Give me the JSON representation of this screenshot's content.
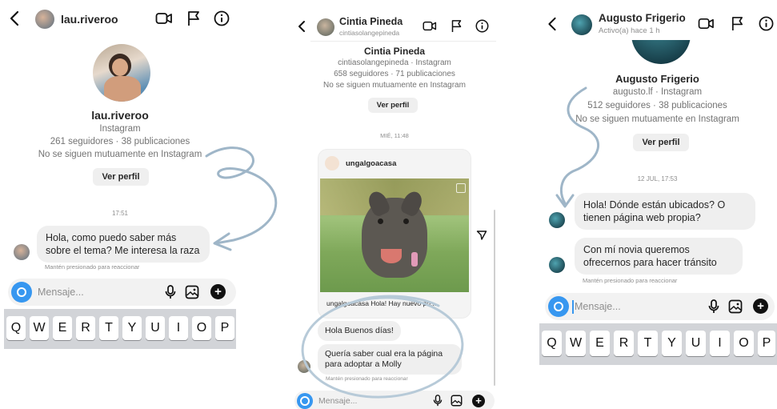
{
  "colors": {
    "accent": "#3797f0",
    "bubble": "#efefef",
    "annotation": "#9fb6c8",
    "keyboard": "#d2d4d8"
  },
  "panels": [
    {
      "header": {
        "name": "lau.riveroo",
        "icons": [
          "back-chevron-icon",
          "video-call-icon",
          "flag-icon",
          "info-icon"
        ]
      },
      "profile": {
        "name": "lau.riveroo",
        "platform": "Instagram",
        "stats": "261 seguidores · 38 publicaciones",
        "mutual": "No se siguen mutuamente en Instagram",
        "button": "Ver perfil"
      },
      "timestamp": "17:51",
      "messages": [
        {
          "text": "Hola, como puedo saber más sobre el tema? Me interesa la raza"
        }
      ],
      "hint": "Mantén presionado para reaccionar",
      "composer": {
        "placeholder": "Mensaje..."
      },
      "keyboard": [
        "Q",
        "W",
        "E",
        "R",
        "T",
        "Y",
        "U",
        "I",
        "O",
        "P"
      ]
    },
    {
      "header": {
        "name": "Cintia Pineda",
        "username": "cintiasolangepineda"
      },
      "profile": {
        "name": "Cintia Pineda",
        "platform": "cintiasolangepineda · Instagram",
        "stats": "658 seguidores · 71 publicaciones",
        "mutual": "No se siguen mutuamente en Instagram",
        "button": "Ver perfil"
      },
      "timestamp": "MIÉ, 11:48",
      "shared_post": {
        "author": "ungalgoacasa",
        "caption": "ungalgoacasa Hola! Hay nuevo po..."
      },
      "messages": [
        {
          "text": "Hola Buenos días!"
        },
        {
          "text": "Quería saber cual era la página para adoptar a Molly"
        }
      ],
      "hint": "Mantén presionado para reaccionar",
      "composer": {
        "placeholder": "Mensaje..."
      }
    },
    {
      "header": {
        "name": "Augusto Frigerio",
        "status": "Activo(a) hace 1 h"
      },
      "profile": {
        "name": "Augusto Frigerio",
        "platform": "augusto.lf · Instagram",
        "stats": "512 seguidores · 38 publicaciones",
        "mutual": "No se siguen mutuamente en Instagram",
        "button": "Ver perfil"
      },
      "timestamp": "12 JUL, 17:53",
      "messages": [
        {
          "text": "Hola! Dónde están ubicados? O tienen página web propia?"
        },
        {
          "text": "Con mí novia queremos ofrecernos para hacer tránsito"
        }
      ],
      "hint": "Mantén presionado para reaccionar",
      "composer": {
        "placeholder": "Mensaje..."
      },
      "keyboard": [
        "Q",
        "W",
        "E",
        "R",
        "T",
        "Y",
        "U",
        "I",
        "O",
        "P"
      ]
    }
  ]
}
